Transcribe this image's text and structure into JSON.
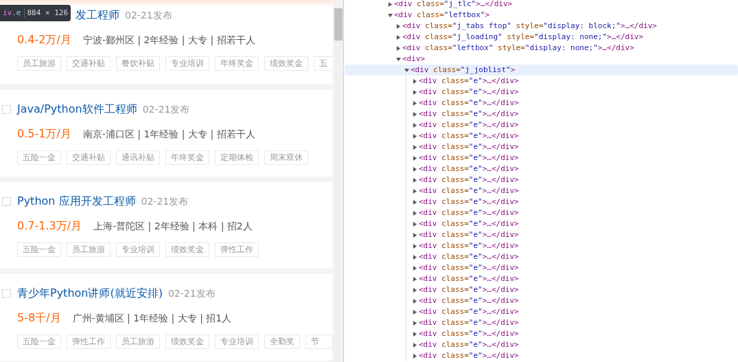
{
  "tooltip": {
    "element": "iv",
    "selector": ".e",
    "size": "884 × 126"
  },
  "jobs": [
    {
      "title": "发工程师",
      "date": "02-21发布",
      "salary": "0.4-2万/月",
      "details": "宁波-鄞州区 | 2年经验 | 大专 | 招若干人",
      "hovered": true,
      "tags": [
        "员工旅游",
        "交通补贴",
        "餐饮补贴",
        "专业培训",
        "年终奖金",
        "绩效奖金",
        "五"
      ]
    },
    {
      "title": "Java/Python软件工程师",
      "date": "02-21发布",
      "salary": "0.5-1万/月",
      "details": "南京-浦口区 | 1年经验 | 大专 | 招若干人",
      "hovered": false,
      "tags": [
        "五险一金",
        "交通补贴",
        "通讯补贴",
        "年终奖金",
        "定期体检",
        "周末双休"
      ]
    },
    {
      "title": "Python 应用开发工程师",
      "date": "02-21发布",
      "salary": "0.7-1.3万/月",
      "details": "上海-普陀区 | 2年经验 | 本科 | 招2人",
      "hovered": false,
      "tags": [
        "五险一金",
        "员工旅游",
        "专业培训",
        "绩效奖金",
        "弹性工作"
      ]
    },
    {
      "title": "青少年Python讲师(就近安排)",
      "date": "02-21发布",
      "salary": "5-8千/月",
      "details": "广州-黄埔区 | 1年经验 | 大专 | 招1人",
      "hovered": false,
      "tags": [
        "五险一金",
        "弹性工作",
        "员工旅游",
        "绩效奖金",
        "专业培训",
        "全勤奖",
        "节"
      ]
    }
  ],
  "dom_tree": [
    {
      "expanded": false,
      "selected": false,
      "parts": [
        {
          "kind": "tag",
          "text": "<div"
        },
        {
          "kind": "attr",
          "text": " class="
        },
        {
          "kind": "value",
          "text": "\"j_tlc\""
        },
        {
          "kind": "tag",
          "text": ">…</div>"
        }
      ]
    },
    {
      "expanded": true,
      "selected": false,
      "parts": [
        {
          "kind": "tag",
          "text": "<div"
        },
        {
          "kind": "attr",
          "text": " class="
        },
        {
          "kind": "value",
          "text": "\"leftbox\""
        },
        {
          "kind": "tag",
          "text": ">"
        }
      ],
      "children": [
        {
          "expanded": false,
          "selected": false,
          "parts": [
            {
              "kind": "tag",
              "text": "<div"
            },
            {
              "kind": "attr",
              "text": " class="
            },
            {
              "kind": "value",
              "text": "\"j_tabs ftop\""
            },
            {
              "kind": "attr",
              "text": " style="
            },
            {
              "kind": "value",
              "text": "\"display: block;\""
            },
            {
              "kind": "tag",
              "text": ">…</div>"
            }
          ]
        },
        {
          "expanded": false,
          "selected": false,
          "parts": [
            {
              "kind": "tag",
              "text": "<div"
            },
            {
              "kind": "attr",
              "text": " class="
            },
            {
              "kind": "value",
              "text": "\"j_loading\""
            },
            {
              "kind": "attr",
              "text": " style="
            },
            {
              "kind": "value",
              "text": "\"display: none;\""
            },
            {
              "kind": "tag",
              "text": ">…</div>"
            }
          ]
        },
        {
          "expanded": false,
          "selected": false,
          "parts": [
            {
              "kind": "tag",
              "text": "<div"
            },
            {
              "kind": "attr",
              "text": " class="
            },
            {
              "kind": "value",
              "text": "\"leftbox\""
            },
            {
              "kind": "attr",
              "text": " style="
            },
            {
              "kind": "value",
              "text": "\"display: none;\""
            },
            {
              "kind": "tag",
              "text": ">…</div>"
            }
          ]
        },
        {
          "expanded": true,
          "selected": false,
          "parts": [
            {
              "kind": "tag",
              "text": "<div>"
            }
          ],
          "children": [
            {
              "expanded": true,
              "selected": true,
              "parts": [
                {
                  "kind": "tag",
                  "text": "<div"
                },
                {
                  "kind": "attr",
                  "text": " class="
                },
                {
                  "kind": "value",
                  "text": "\"j_joblist\""
                },
                {
                  "kind": "tag",
                  "text": ">"
                }
              ],
              "children": [
                {
                  "expanded": false,
                  "selected": false,
                  "parts": [
                    {
                      "kind": "tag",
                      "text": "<div"
                    },
                    {
                      "kind": "attr",
                      "text": " class="
                    },
                    {
                      "kind": "value",
                      "text": "\"e\""
                    },
                    {
                      "kind": "tag",
                      "text": ">…</div>"
                    }
                  ]
                },
                {
                  "expanded": false,
                  "selected": false,
                  "parts": [
                    {
                      "kind": "tag",
                      "text": "<div"
                    },
                    {
                      "kind": "attr",
                      "text": " class="
                    },
                    {
                      "kind": "value",
                      "text": "\"e\""
                    },
                    {
                      "kind": "tag",
                      "text": ">…</div>"
                    }
                  ]
                },
                {
                  "expanded": false,
                  "selected": false,
                  "parts": [
                    {
                      "kind": "tag",
                      "text": "<div"
                    },
                    {
                      "kind": "attr",
                      "text": " class="
                    },
                    {
                      "kind": "value",
                      "text": "\"e\""
                    },
                    {
                      "kind": "tag",
                      "text": ">…</div>"
                    }
                  ]
                },
                {
                  "expanded": false,
                  "selected": false,
                  "parts": [
                    {
                      "kind": "tag",
                      "text": "<div"
                    },
                    {
                      "kind": "attr",
                      "text": " class="
                    },
                    {
                      "kind": "value",
                      "text": "\"e\""
                    },
                    {
                      "kind": "tag",
                      "text": ">…</div>"
                    }
                  ]
                },
                {
                  "expanded": false,
                  "selected": false,
                  "parts": [
                    {
                      "kind": "tag",
                      "text": "<div"
                    },
                    {
                      "kind": "attr",
                      "text": " class="
                    },
                    {
                      "kind": "value",
                      "text": "\"e\""
                    },
                    {
                      "kind": "tag",
                      "text": ">…</div>"
                    }
                  ]
                },
                {
                  "expanded": false,
                  "selected": false,
                  "parts": [
                    {
                      "kind": "tag",
                      "text": "<div"
                    },
                    {
                      "kind": "attr",
                      "text": " class="
                    },
                    {
                      "kind": "value",
                      "text": "\"e\""
                    },
                    {
                      "kind": "tag",
                      "text": ">…</div>"
                    }
                  ]
                },
                {
                  "expanded": false,
                  "selected": false,
                  "parts": [
                    {
                      "kind": "tag",
                      "text": "<div"
                    },
                    {
                      "kind": "attr",
                      "text": " class="
                    },
                    {
                      "kind": "value",
                      "text": "\"e\""
                    },
                    {
                      "kind": "tag",
                      "text": ">…</div>"
                    }
                  ]
                },
                {
                  "expanded": false,
                  "selected": false,
                  "parts": [
                    {
                      "kind": "tag",
                      "text": "<div"
                    },
                    {
                      "kind": "attr",
                      "text": " class="
                    },
                    {
                      "kind": "value",
                      "text": "\"e\""
                    },
                    {
                      "kind": "tag",
                      "text": ">…</div>"
                    }
                  ]
                },
                {
                  "expanded": false,
                  "selected": false,
                  "parts": [
                    {
                      "kind": "tag",
                      "text": "<div"
                    },
                    {
                      "kind": "attr",
                      "text": " class="
                    },
                    {
                      "kind": "value",
                      "text": "\"e\""
                    },
                    {
                      "kind": "tag",
                      "text": ">…</div>"
                    }
                  ]
                },
                {
                  "expanded": false,
                  "selected": false,
                  "parts": [
                    {
                      "kind": "tag",
                      "text": "<div"
                    },
                    {
                      "kind": "attr",
                      "text": " class="
                    },
                    {
                      "kind": "value",
                      "text": "\"e\""
                    },
                    {
                      "kind": "tag",
                      "text": ">…</div>"
                    }
                  ]
                },
                {
                  "expanded": false,
                  "selected": false,
                  "parts": [
                    {
                      "kind": "tag",
                      "text": "<div"
                    },
                    {
                      "kind": "attr",
                      "text": " class="
                    },
                    {
                      "kind": "value",
                      "text": "\"e\""
                    },
                    {
                      "kind": "tag",
                      "text": ">…</div>"
                    }
                  ]
                },
                {
                  "expanded": false,
                  "selected": false,
                  "parts": [
                    {
                      "kind": "tag",
                      "text": "<div"
                    },
                    {
                      "kind": "attr",
                      "text": " class="
                    },
                    {
                      "kind": "value",
                      "text": "\"e\""
                    },
                    {
                      "kind": "tag",
                      "text": ">…</div>"
                    }
                  ]
                },
                {
                  "expanded": false,
                  "selected": false,
                  "parts": [
                    {
                      "kind": "tag",
                      "text": "<div"
                    },
                    {
                      "kind": "attr",
                      "text": " class="
                    },
                    {
                      "kind": "value",
                      "text": "\"e\""
                    },
                    {
                      "kind": "tag",
                      "text": ">…</div>"
                    }
                  ]
                },
                {
                  "expanded": false,
                  "selected": false,
                  "parts": [
                    {
                      "kind": "tag",
                      "text": "<div"
                    },
                    {
                      "kind": "attr",
                      "text": " class="
                    },
                    {
                      "kind": "value",
                      "text": "\"e\""
                    },
                    {
                      "kind": "tag",
                      "text": ">…</div>"
                    }
                  ]
                },
                {
                  "expanded": false,
                  "selected": false,
                  "parts": [
                    {
                      "kind": "tag",
                      "text": "<div"
                    },
                    {
                      "kind": "attr",
                      "text": " class="
                    },
                    {
                      "kind": "value",
                      "text": "\"e\""
                    },
                    {
                      "kind": "tag",
                      "text": ">…</div>"
                    }
                  ]
                },
                {
                  "expanded": false,
                  "selected": false,
                  "parts": [
                    {
                      "kind": "tag",
                      "text": "<div"
                    },
                    {
                      "kind": "attr",
                      "text": " class="
                    },
                    {
                      "kind": "value",
                      "text": "\"e\""
                    },
                    {
                      "kind": "tag",
                      "text": ">…</div>"
                    }
                  ]
                },
                {
                  "expanded": false,
                  "selected": false,
                  "parts": [
                    {
                      "kind": "tag",
                      "text": "<div"
                    },
                    {
                      "kind": "attr",
                      "text": " class="
                    },
                    {
                      "kind": "value",
                      "text": "\"e\""
                    },
                    {
                      "kind": "tag",
                      "text": ">…</div>"
                    }
                  ]
                },
                {
                  "expanded": false,
                  "selected": false,
                  "parts": [
                    {
                      "kind": "tag",
                      "text": "<div"
                    },
                    {
                      "kind": "attr",
                      "text": " class="
                    },
                    {
                      "kind": "value",
                      "text": "\"e\""
                    },
                    {
                      "kind": "tag",
                      "text": ">…</div>"
                    }
                  ]
                },
                {
                  "expanded": false,
                  "selected": false,
                  "parts": [
                    {
                      "kind": "tag",
                      "text": "<div"
                    },
                    {
                      "kind": "attr",
                      "text": " class="
                    },
                    {
                      "kind": "value",
                      "text": "\"e\""
                    },
                    {
                      "kind": "tag",
                      "text": ">…</div>"
                    }
                  ]
                },
                {
                  "expanded": false,
                  "selected": false,
                  "parts": [
                    {
                      "kind": "tag",
                      "text": "<div"
                    },
                    {
                      "kind": "attr",
                      "text": " class="
                    },
                    {
                      "kind": "value",
                      "text": "\"e\""
                    },
                    {
                      "kind": "tag",
                      "text": ">…</div>"
                    }
                  ]
                },
                {
                  "expanded": false,
                  "selected": false,
                  "parts": [
                    {
                      "kind": "tag",
                      "text": "<div"
                    },
                    {
                      "kind": "attr",
                      "text": " class="
                    },
                    {
                      "kind": "value",
                      "text": "\"e\""
                    },
                    {
                      "kind": "tag",
                      "text": ">…</div>"
                    }
                  ]
                },
                {
                  "expanded": false,
                  "selected": false,
                  "parts": [
                    {
                      "kind": "tag",
                      "text": "<div"
                    },
                    {
                      "kind": "attr",
                      "text": " class="
                    },
                    {
                      "kind": "value",
                      "text": "\"e\""
                    },
                    {
                      "kind": "tag",
                      "text": ">…</div>"
                    }
                  ]
                },
                {
                  "expanded": false,
                  "selected": false,
                  "parts": [
                    {
                      "kind": "tag",
                      "text": "<div"
                    },
                    {
                      "kind": "attr",
                      "text": " class="
                    },
                    {
                      "kind": "value",
                      "text": "\"e\""
                    },
                    {
                      "kind": "tag",
                      "text": ">…</div>"
                    }
                  ]
                },
                {
                  "expanded": false,
                  "selected": false,
                  "parts": [
                    {
                      "kind": "tag",
                      "text": "<div"
                    },
                    {
                      "kind": "attr",
                      "text": " class="
                    },
                    {
                      "kind": "value",
                      "text": "\"e\""
                    },
                    {
                      "kind": "tag",
                      "text": ">…</div>"
                    }
                  ]
                },
                {
                  "expanded": false,
                  "selected": false,
                  "parts": [
                    {
                      "kind": "tag",
                      "text": "<div"
                    },
                    {
                      "kind": "attr",
                      "text": " class="
                    },
                    {
                      "kind": "value",
                      "text": "\"e\""
                    },
                    {
                      "kind": "tag",
                      "text": ">…</div>"
                    }
                  ]
                },
                {
                  "expanded": false,
                  "selected": false,
                  "parts": [
                    {
                      "kind": "tag",
                      "text": "<div"
                    },
                    {
                      "kind": "attr",
                      "text": " class="
                    },
                    {
                      "kind": "value",
                      "text": "\"e\""
                    },
                    {
                      "kind": "tag",
                      "text": ">…</div>"
                    }
                  ]
                }
              ]
            }
          ]
        }
      ]
    }
  ]
}
